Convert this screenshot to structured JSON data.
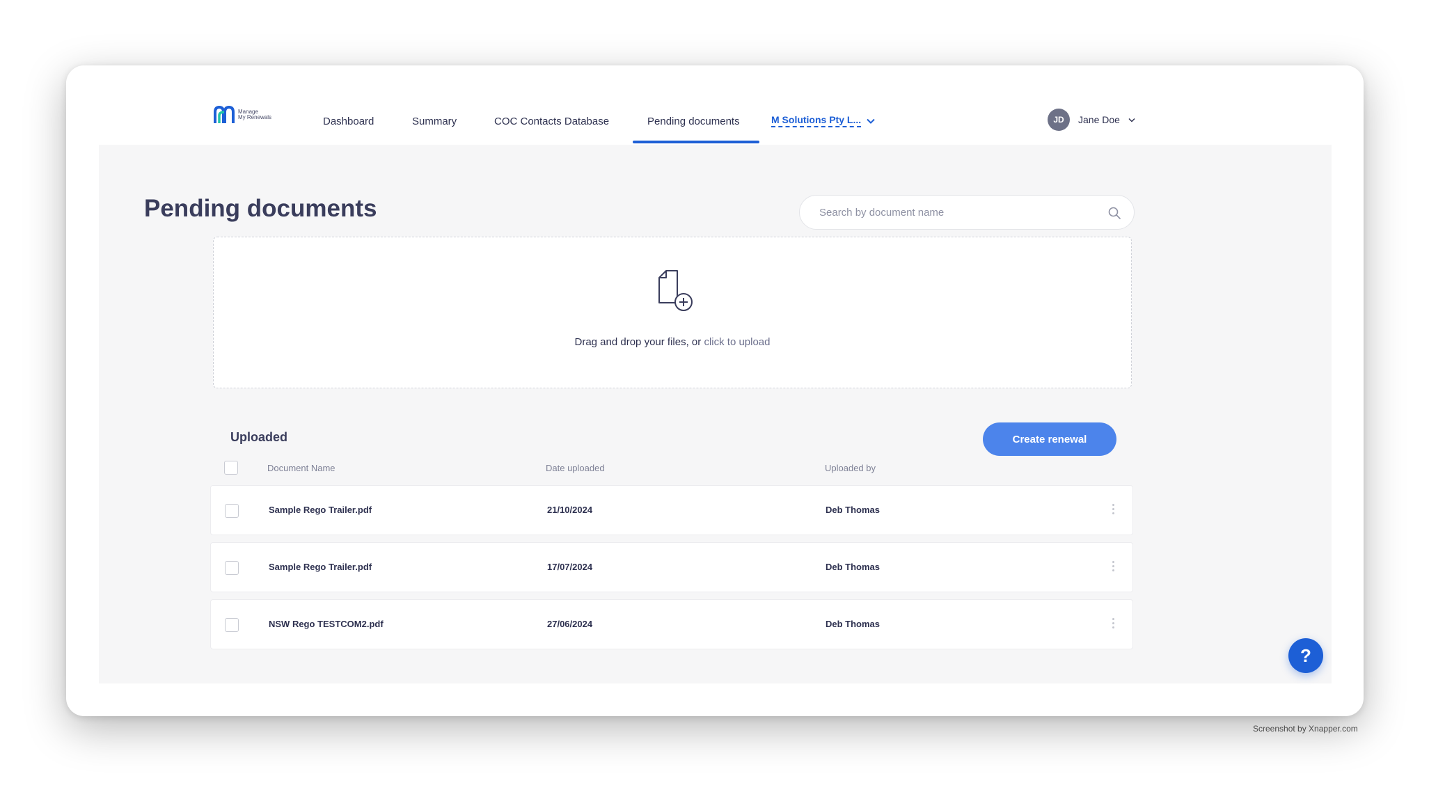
{
  "header": {
    "logo_text": [
      "Manage",
      "My Renewals"
    ],
    "nav": [
      {
        "label": "Dashboard"
      },
      {
        "label": "Summary"
      },
      {
        "label": "COC Contacts Database"
      },
      {
        "label": "Pending documents",
        "active": true
      }
    ],
    "org_select": {
      "value": "M Solutions Pty L..."
    },
    "user": {
      "initials": "JD",
      "name": "Jane Doe"
    }
  },
  "page": {
    "title": "Pending documents"
  },
  "search": {
    "placeholder": "Search by document name",
    "value": ""
  },
  "dropzone": {
    "text": "Drag and drop your files, or ",
    "link": "click to upload"
  },
  "uploaded": {
    "title": "Uploaded",
    "create_button": "Create renewal",
    "columns": [
      "Document Name",
      "Date uploaded",
      "Uploaded by"
    ],
    "rows": [
      {
        "name": "Sample Rego Trailer.pdf",
        "date": "21/10/2024",
        "by": "Deb Thomas"
      },
      {
        "name": "Sample Rego Trailer.pdf",
        "date": "17/07/2024",
        "by": "Deb Thomas"
      },
      {
        "name": "NSW Rego TESTCOM2.pdf",
        "date": "27/06/2024",
        "by": "Deb Thomas"
      }
    ]
  },
  "help_button": "?",
  "watermark": "Screenshot by Xnapper.com",
  "colors": {
    "accent": "#1d5fd6",
    "button": "#4c84eb",
    "background": "#f6f6f7",
    "text": "#3a3d5c"
  }
}
